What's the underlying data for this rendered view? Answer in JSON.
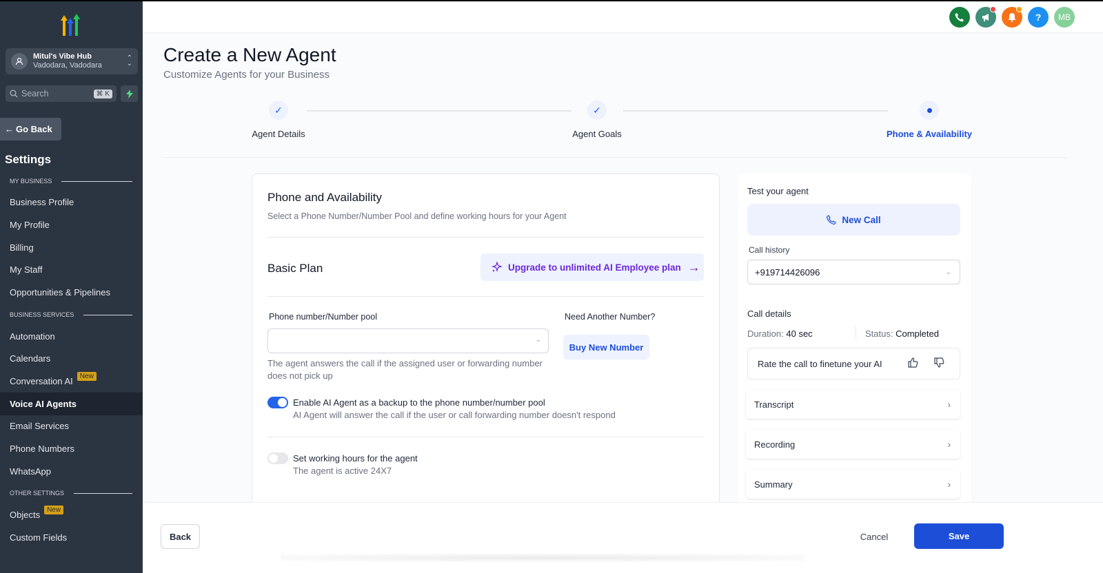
{
  "sidebar": {
    "account": {
      "name": "Mitul's Vibe Hub",
      "location": "Vadodara, Vadodara"
    },
    "search": {
      "placeholder": "Search",
      "shortcut": "⌘ K"
    },
    "go_back": "Go Back",
    "settings_title": "Settings",
    "sections": {
      "my_business": "MY BUSINESS",
      "business_services": "BUSINESS SERVICES",
      "other_settings": "OTHER SETTINGS"
    },
    "items": {
      "business_profile": "Business Profile",
      "my_profile": "My Profile",
      "billing": "Billing",
      "my_staff": "My Staff",
      "opportunities": "Opportunities & Pipelines",
      "automation": "Automation",
      "calendars": "Calendars",
      "conversation_ai": "Conversation AI",
      "voice_ai_agents": "Voice AI Agents",
      "email_services": "Email Services",
      "phone_numbers": "Phone Numbers",
      "whatsapp": "WhatsApp",
      "objects": "Objects",
      "custom_fields": "Custom Fields"
    },
    "badge_new": "New"
  },
  "topbar": {
    "avatar_initials": "MB",
    "help": "?"
  },
  "page": {
    "title": "Create a New Agent",
    "subtitle": "Customize Agents for your Business",
    "steps": [
      "Agent Details",
      "Agent Goals",
      "Phone & Availability"
    ]
  },
  "card": {
    "title": "Phone and Availability",
    "subtitle": "Select a Phone Number/Number Pool and define working hours for your Agent",
    "plan": "Basic Plan",
    "upgrade_label": "Upgrade to unlimited AI Employee plan",
    "phone_label": "Phone number/Number pool",
    "need_another": "Need Another Number?",
    "buy_number": "Buy New Number",
    "helper": "The agent answers the call if the assigned user or forwarding number does not pick up",
    "backup_title": "Enable AI Agent as a backup to the phone number/number pool",
    "backup_sub": "AI Agent will answer the call if the user or call forwarding number doesn't respond",
    "hours_title": "Set working hours for the agent",
    "hours_sub": "The agent is active 24X7"
  },
  "test_panel": {
    "title": "Test your agent",
    "new_call": "New Call",
    "history_label": "Call history",
    "history_value": "+919714426096",
    "details_label": "Call details",
    "duration_label": "Duration:",
    "duration_value": "40 sec",
    "status_label": "Status:",
    "status_value": "Completed",
    "rate_label": "Rate the call to finetune your AI",
    "transcript": "Transcript",
    "recording": "Recording",
    "summary": "Summary"
  },
  "footer": {
    "back": "Back",
    "cancel": "Cancel",
    "save": "Save"
  },
  "colors": {
    "accent": "#1d4ed8",
    "sidebar": "#2b3441",
    "upgrade_text": "#6d28d9"
  }
}
